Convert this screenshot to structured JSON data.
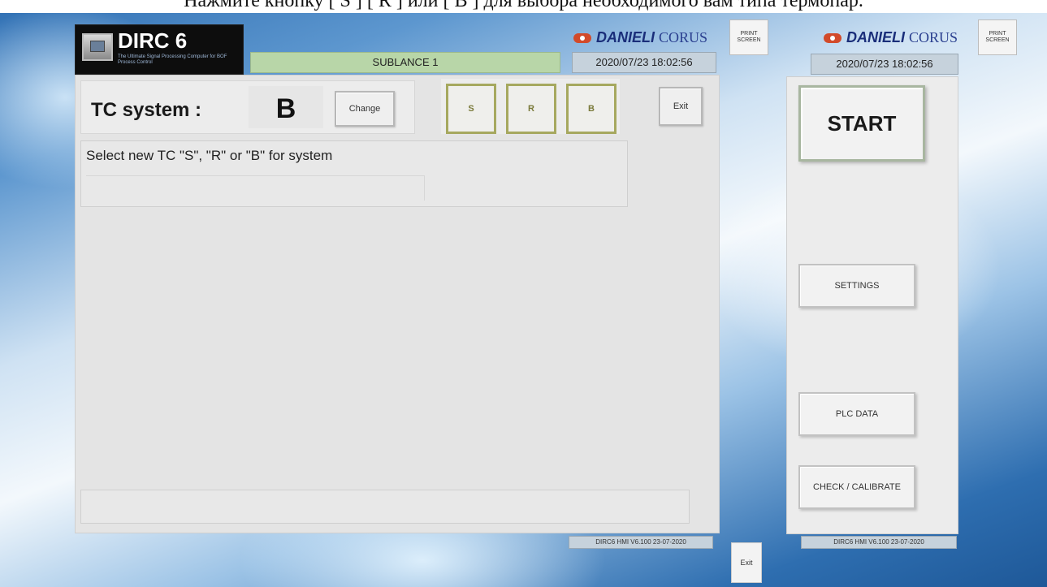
{
  "caption": "Нажмите кнопку [ S ] [ R ] или [ B ] для выбора необходимого вам типа термопар.",
  "logo": {
    "title": "DIRC 6",
    "subtitle": "The Ultimate Signal Processing Computer for BOF Process Control"
  },
  "left_window": {
    "title": "SUBLANCE 1",
    "brand": "DANIELI",
    "brand_suffix": "CORUS",
    "datetime": "2020/07/23 18:02:56",
    "print_button": "PRINT SCREEN",
    "tc_label": "TC system :",
    "tc_value": "B",
    "change_button": "Change",
    "select_buttons": [
      "S",
      "R",
      "B"
    ],
    "exit_button": "Exit",
    "message": "Select new TC \"S\", \"R\" or \"B\" for system",
    "version": "DIRC6 HMI V6.100 23-07-2020"
  },
  "right_window": {
    "brand": "DANIELI",
    "brand_suffix": "CORUS",
    "datetime": "2020/07/23 18:02:56",
    "print_button": "PRINT SCREEN",
    "start_button": "START",
    "settings_button": "SETTINGS",
    "plc_button": "PLC DATA",
    "check_button": "CHECK / CALIBRATE",
    "version": "DIRC6 HMI V6.100 23-07-2020"
  },
  "bottom_exit": "Exit"
}
